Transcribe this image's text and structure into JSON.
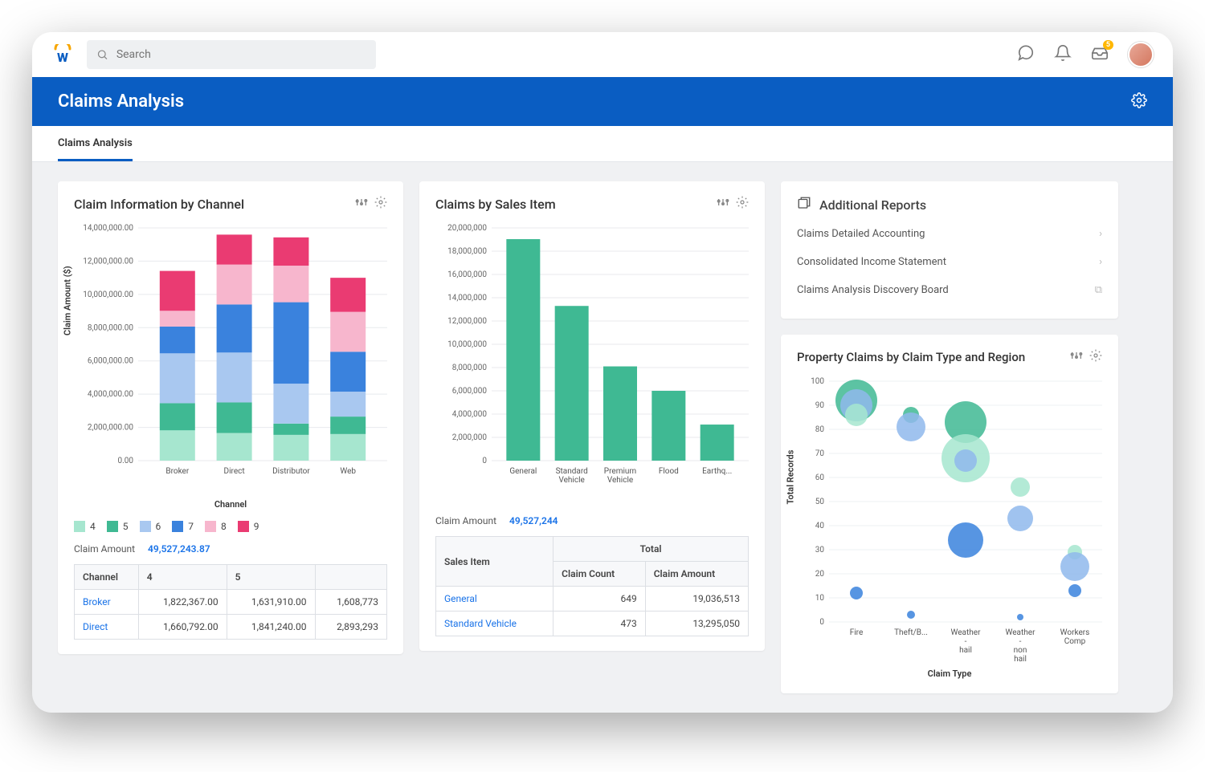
{
  "search": {
    "placeholder": "Search"
  },
  "header": {
    "title": "Claims Analysis"
  },
  "tabs": [
    {
      "label": "Claims Analysis"
    }
  ],
  "inbox_badge": "5",
  "colors": {
    "s4": "#a6e6cf",
    "s5": "#3fb993",
    "s6": "#a9c8f0",
    "s7": "#3a82dd",
    "s8": "#f7b6cd",
    "s9": "#ea3b72",
    "bar": "#3fb993",
    "bubble_a": "#3fb993",
    "bubble_b": "#3a82dd",
    "bubble_c": "#a6e6cf"
  },
  "card1": {
    "title": "Claim Information by Channel",
    "metric_label": "Claim Amount",
    "metric_value": "49,527,243.87",
    "table_headers": [
      "Channel",
      "4",
      "5"
    ],
    "table_extra_col": "",
    "rows": [
      {
        "name": "Broker",
        "c4": "1,822,367.00",
        "c5": "1,631,910.00",
        "c6": "1,608,773"
      },
      {
        "name": "Direct",
        "c4": "1,660,792.00",
        "c5": "1,841,240.00",
        "c6": "2,893,293"
      }
    ]
  },
  "card2": {
    "title": "Claims by Sales Item",
    "metric_label": "Claim Amount",
    "metric_value": "49,527,244",
    "table": {
      "h1": "Sales Item",
      "h2": "Total",
      "h2a": "Claim Count",
      "h2b": "Claim Amount",
      "rows": [
        {
          "name": "General",
          "count": "649",
          "amt": "19,036,513"
        },
        {
          "name": "Standard Vehicle",
          "count": "473",
          "amt": "13,295,050"
        }
      ]
    }
  },
  "card3": {
    "title": "Additional Reports",
    "items": [
      {
        "label": "Claims Detailed Accounting"
      },
      {
        "label": "Consolidated Income Statement"
      },
      {
        "label": "Claims Analysis Discovery Board"
      }
    ]
  },
  "card4": {
    "title": "Property Claims by Claim Type and Region",
    "ylabel": "Total Records",
    "xlabel": "Claim Type"
  },
  "chart_data": [
    {
      "id": "claim_by_channel",
      "type": "bar",
      "stacked": true,
      "xlabel": "Channel",
      "ylabel": "Claim Amount ($)",
      "ylim": [
        0,
        14000000
      ],
      "ytick_format": "0,0.00",
      "categories": [
        "Broker",
        "Direct",
        "Distributor",
        "Web"
      ],
      "series": [
        {
          "name": "4",
          "color": "#a6e6cf",
          "values": [
            1822367,
            1660792,
            1550000,
            1600000
          ]
        },
        {
          "name": "5",
          "color": "#3fb993",
          "values": [
            1631910,
            1841240,
            680000,
            1050000
          ]
        },
        {
          "name": "6",
          "color": "#a9c8f0",
          "values": [
            3000000,
            3000000,
            2400000,
            1500000
          ]
        },
        {
          "name": "7",
          "color": "#3a82dd",
          "values": [
            1608773,
            2893293,
            4900000,
            2400000
          ]
        },
        {
          "name": "8",
          "color": "#f7b6cd",
          "values": [
            950000,
            2400000,
            2200000,
            2400000
          ]
        },
        {
          "name": "9",
          "color": "#ea3b72",
          "values": [
            2400000,
            1800000,
            1700000,
            2050000
          ]
        }
      ],
      "legend": [
        "4",
        "5",
        "6",
        "7",
        "8",
        "9"
      ]
    },
    {
      "id": "claims_by_sales_item",
      "type": "bar",
      "xlabel": "",
      "ylabel": "",
      "ylim": [
        0,
        20000000
      ],
      "categories": [
        "General",
        "Standard Vehicle",
        "Premium Vehicle",
        "Flood",
        "Earthq..."
      ],
      "values": [
        19036513,
        13295050,
        8100000,
        6000000,
        3100000
      ]
    },
    {
      "id": "property_claims_bubble",
      "type": "scatter",
      "xlabel": "Claim Type",
      "ylabel": "Total Records",
      "ylim": [
        0,
        100
      ],
      "x_categories": [
        "Fire",
        "Theft/B...",
        "Weather - hail",
        "Weather - non hail",
        "Workers Comp"
      ],
      "points": [
        {
          "x": "Fire",
          "y": 92,
          "size": 26,
          "series": "a"
        },
        {
          "x": "Fire",
          "y": 90,
          "size": 20,
          "series": "b_light"
        },
        {
          "x": "Fire",
          "y": 86,
          "size": 14,
          "series": "c"
        },
        {
          "x": "Fire",
          "y": 12,
          "size": 8,
          "series": "b"
        },
        {
          "x": "Theft/B...",
          "y": 86,
          "size": 10,
          "series": "a"
        },
        {
          "x": "Theft/B...",
          "y": 81,
          "size": 18,
          "series": "b_light"
        },
        {
          "x": "Theft/B...",
          "y": 3,
          "size": 5,
          "series": "b"
        },
        {
          "x": "Weather - hail",
          "y": 83,
          "size": 26,
          "series": "a"
        },
        {
          "x": "Weather - hail",
          "y": 68,
          "size": 30,
          "series": "c"
        },
        {
          "x": "Weather - hail",
          "y": 67,
          "size": 14,
          "series": "b_light"
        },
        {
          "x": "Weather - hail",
          "y": 34,
          "size": 22,
          "series": "b"
        },
        {
          "x": "Weather - non hail",
          "y": 56,
          "size": 12,
          "series": "c"
        },
        {
          "x": "Weather - non hail",
          "y": 43,
          "size": 16,
          "series": "b_light"
        },
        {
          "x": "Weather - non hail",
          "y": 2,
          "size": 4,
          "series": "b"
        },
        {
          "x": "Workers Comp",
          "y": 29,
          "size": 9,
          "series": "c"
        },
        {
          "x": "Workers Comp",
          "y": 23,
          "size": 18,
          "series": "b_light"
        },
        {
          "x": "Workers Comp",
          "y": 13,
          "size": 8,
          "series": "b"
        }
      ]
    }
  ]
}
